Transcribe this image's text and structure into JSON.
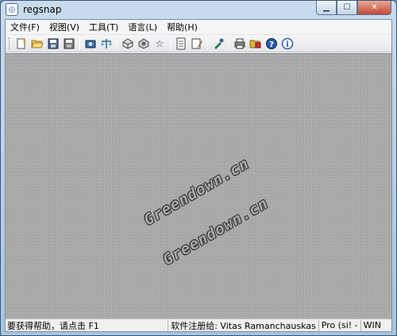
{
  "window": {
    "title": "regsnap"
  },
  "menu": [
    "文件(F)",
    "视图(V)",
    "工具(T)",
    "语言(L)",
    "帮助(H)"
  ],
  "toolbar": {
    "groups": [
      [
        "new-snapshot-icon",
        "open-folder-icon",
        "save-icon",
        "save-as-icon"
      ],
      [
        "camera-icon",
        "compare-scales-icon"
      ],
      [
        "disk-icon",
        "settings-disk-icon",
        "star-icon"
      ],
      [
        "document-icon",
        "edit-document-icon"
      ],
      [
        "tools-icon"
      ],
      [
        "print-icon",
        "print-preview-icon",
        "help-icon",
        "info-icon"
      ]
    ]
  },
  "watermarks": [
    "Greendown.cn",
    "Greendown.cn"
  ],
  "status": {
    "help": "要获得帮助，请点击 F1",
    "registered": "软件注册给: Vitas Ramanchauskas",
    "edition": "Pro (si! -",
    "os": "WIN"
  }
}
